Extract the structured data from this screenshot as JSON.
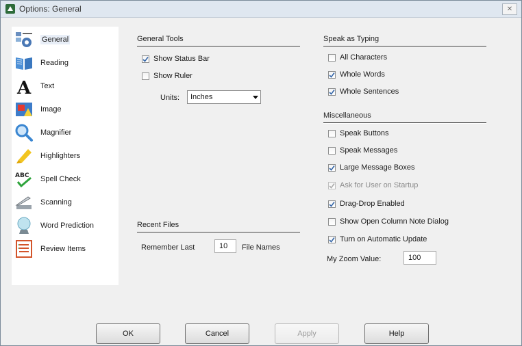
{
  "window": {
    "title": "Options: General"
  },
  "sidebar": {
    "items": [
      {
        "label": "General",
        "icon": "general-settings-icon"
      },
      {
        "label": "Reading",
        "icon": "book-icon"
      },
      {
        "label": "Text",
        "icon": "letter-a-icon"
      },
      {
        "label": "Image",
        "icon": "image-icon"
      },
      {
        "label": "Magnifier",
        "icon": "magnifier-icon"
      },
      {
        "label": "Highlighters",
        "icon": "highlighter-icon"
      },
      {
        "label": "Spell Check",
        "icon": "spell-check-icon"
      },
      {
        "label": "Scanning",
        "icon": "scanner-icon"
      },
      {
        "label": "Word Prediction",
        "icon": "crystal-ball-icon"
      },
      {
        "label": "Review Items",
        "icon": "review-list-icon"
      }
    ],
    "selected": "General"
  },
  "general_tools": {
    "title": "General Tools",
    "show_status_bar": {
      "label": "Show Status Bar",
      "checked": true
    },
    "show_ruler": {
      "label": "Show Ruler",
      "checked": false
    },
    "units_label": "Units:",
    "units_value": "Inches"
  },
  "recent_files": {
    "title": "Recent Files",
    "remember_label": "Remember Last",
    "remember_value": "10",
    "suffix": "File Names"
  },
  "speak_as_typing": {
    "title": "Speak as Typing",
    "options": [
      {
        "label": "All Characters",
        "checked": false
      },
      {
        "label": "Whole Words",
        "checked": true
      },
      {
        "label": "Whole Sentences",
        "checked": true
      }
    ]
  },
  "misc": {
    "title": "Miscellaneous",
    "options": [
      {
        "label": "Speak Buttons",
        "checked": false,
        "enabled": true
      },
      {
        "label": "Speak Messages",
        "checked": false,
        "enabled": true
      },
      {
        "label": "Large Message Boxes",
        "checked": true,
        "enabled": true
      },
      {
        "label": "Ask for User on Startup",
        "checked": true,
        "enabled": false
      },
      {
        "label": "Drag-Drop Enabled",
        "checked": true,
        "enabled": true
      },
      {
        "label": "Show Open Column Note Dialog",
        "checked": false,
        "enabled": true
      },
      {
        "label": "Turn on Automatic Update",
        "checked": true,
        "enabled": true
      }
    ],
    "zoom_label": "My Zoom Value:",
    "zoom_value": "100"
  },
  "buttons": {
    "ok": "OK",
    "cancel": "Cancel",
    "apply": "Apply",
    "help": "Help"
  }
}
